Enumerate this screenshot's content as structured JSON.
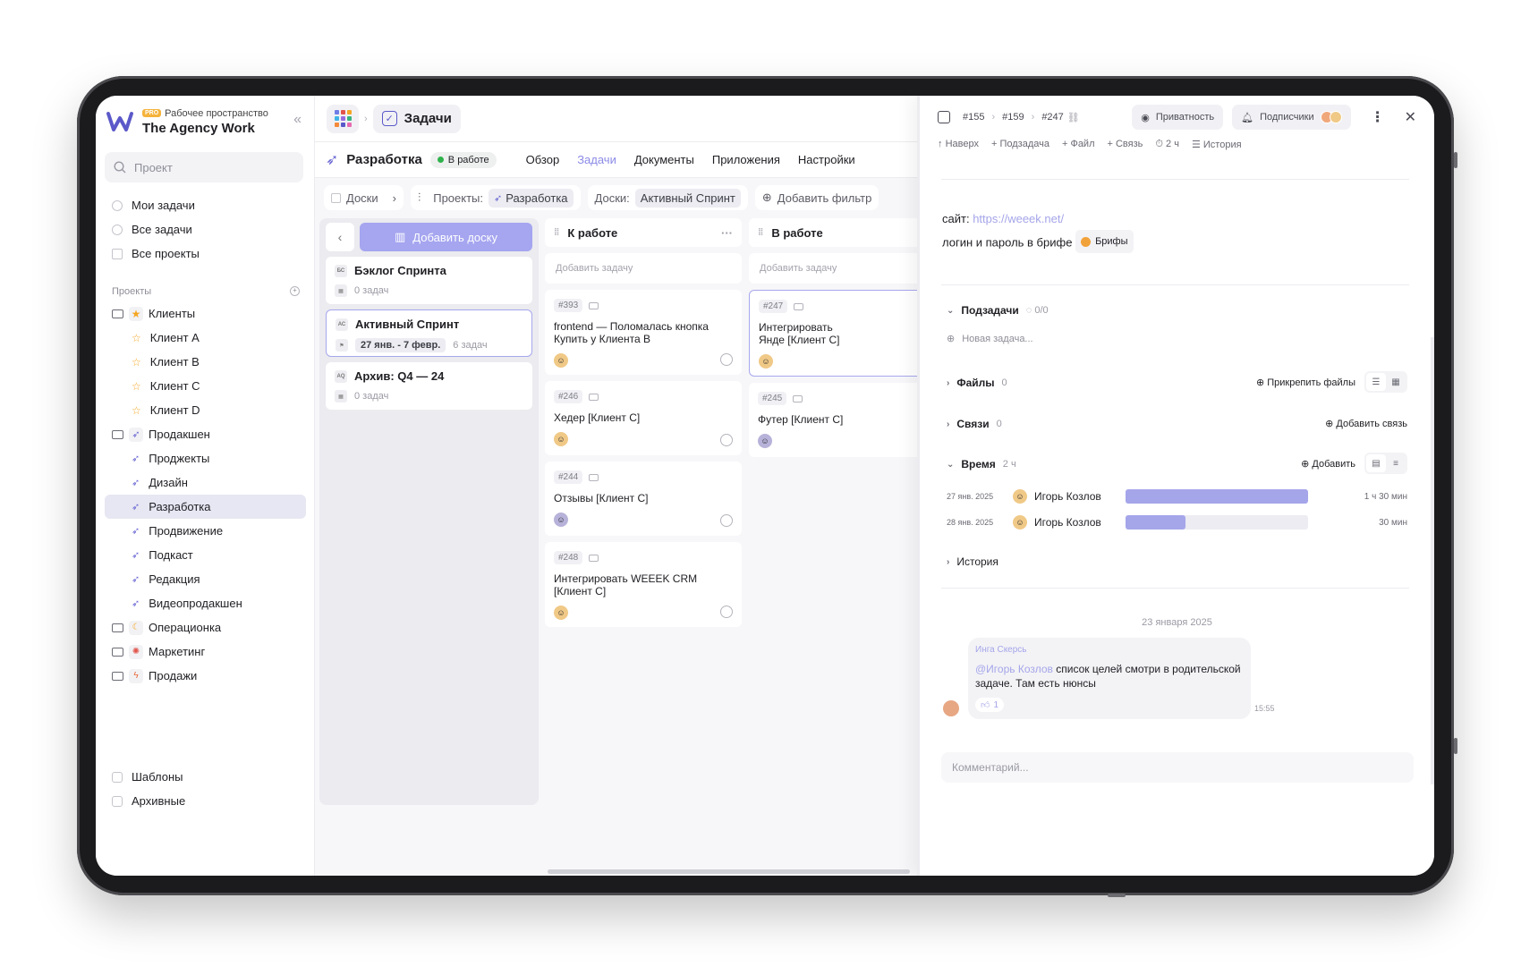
{
  "workspace": {
    "badge": "PRO",
    "subtitle": "Рабочее пространство",
    "name": "The Agency Work"
  },
  "search": {
    "placeholder": "Проект"
  },
  "nav": [
    {
      "label": "Мои задачи"
    },
    {
      "label": "Все задачи"
    },
    {
      "label": "Все проекты"
    }
  ],
  "projects": {
    "header": "Проекты",
    "groups": [
      {
        "label": "Клиенты",
        "icon": "star",
        "children": [
          "Клиент A",
          "Клиент B",
          "Клиент C",
          "Клиент D"
        ]
      },
      {
        "label": "Продакшен",
        "icon": "rocket",
        "children": [
          "Проджекты",
          "Дизайн",
          "Разработка",
          "Продвижение",
          "Подкаст",
          "Редакция",
          "Видеопродакшен"
        ]
      },
      {
        "label": "Операционка",
        "icon": "moon",
        "children": []
      },
      {
        "label": "Маркетинг",
        "icon": "target",
        "children": []
      },
      {
        "label": "Продажи",
        "icon": "bolt",
        "children": []
      }
    ],
    "active": "Разработка"
  },
  "bottom_nav": [
    {
      "label": "Шаблоны"
    },
    {
      "label": "Архивные"
    }
  ],
  "topbar": {
    "section": "Задачи"
  },
  "project": {
    "title": "Разработка",
    "status": "В работе",
    "status_color": "#2fb24c",
    "tabs": [
      "Обзор",
      "Задачи",
      "Документы",
      "Приложения",
      "Настройки"
    ],
    "active_tab": "Задачи"
  },
  "filters": {
    "boards_label": "Доски",
    "projects_label": "Проекты:",
    "projects_value": "Разработка",
    "boards_filter_label": "Доски:",
    "boards_filter_value": "Активный Спринт",
    "add_filter": "Добавить фильтр"
  },
  "boards": {
    "add_label": "Добавить доску",
    "items": [
      {
        "abbr": "БС",
        "title": "Бэклог Спринта",
        "meta": "0 задач",
        "date": ""
      },
      {
        "abbr": "АС",
        "title": "Активный Спринт",
        "meta": "6 задач",
        "date": "27 янв. - 7 февр."
      },
      {
        "abbr": "AQ",
        "title": "Архив: Q4 — 24",
        "meta": "0 задач",
        "date": ""
      }
    ]
  },
  "columns": [
    {
      "title": "К работе",
      "add_label": "Добавить задачу",
      "cards": [
        {
          "id": "#393",
          "title": "frontend — Поломалась кнопка Купить у Клиента B"
        },
        {
          "id": "#246",
          "title": "Хедер [Клиент C]"
        },
        {
          "id": "#244",
          "title": "Отзывы [Клиент C]"
        },
        {
          "id": "#248",
          "title": "Интегрировать WEEEK CRM [Клиент C]"
        }
      ]
    },
    {
      "title": "В работе",
      "add_label": "Добавить задачу",
      "cards": [
        {
          "id": "#247",
          "title": "Интегрировать Янде [Клиент C]"
        },
        {
          "id": "#245",
          "title": "Футер [Клиент C]"
        }
      ]
    }
  ],
  "panel": {
    "breadcrumb": [
      "#155",
      "#159",
      "#247"
    ],
    "privacy": "Приватность",
    "subscribers": "Подписчики",
    "actions": [
      "Наверх",
      "Подзадача",
      "Файл",
      "Связь",
      "2 ч",
      "История"
    ],
    "desc_site_label": "сайт:",
    "desc_site_url": "https://weeek.net/",
    "desc_login": "логин и пароль в брифе",
    "desc_brief": "Брифы",
    "subtasks": {
      "label": "Подзадачи",
      "count": "0/0",
      "new": "Новая задача..."
    },
    "files": {
      "label": "Файлы",
      "count": "0",
      "action": "Прикрепить файлы"
    },
    "links": {
      "label": "Связи",
      "count": "0",
      "action": "Добавить связь"
    },
    "time": {
      "label": "Время",
      "count": "2 ч",
      "action": "Добавить",
      "rows": [
        {
          "date": "27 янв. 2025",
          "user": "Игорь Козлов",
          "fill": 1.0,
          "duration": "1 ч 30 мин"
        },
        {
          "date": "28 янв. 2025",
          "user": "Игорь Козлов",
          "fill": 0.33,
          "duration": "30 мин"
        }
      ]
    },
    "history": {
      "label": "История"
    },
    "comment_date": "23 января 2025",
    "comment": {
      "author": "Инга Скерсь",
      "mention": "@Игорь Козлов",
      "text": " список целей смотри в родительской задаче. Там есть нюнсы",
      "reaction": "1",
      "time": "15:55"
    },
    "comment_placeholder": "Комментарий..."
  }
}
